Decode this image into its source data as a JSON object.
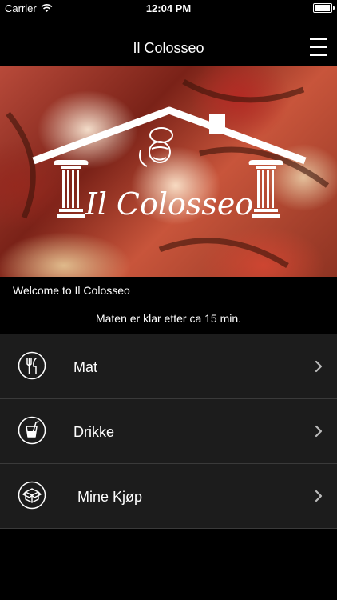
{
  "status_bar": {
    "carrier": "Carrier",
    "time": "12:04 PM"
  },
  "nav": {
    "title": "Il Colosseo",
    "menu_icon": "hamburger-menu-icon"
  },
  "hero": {
    "logo_text": "Il Colosseo"
  },
  "welcome": "Welcome to Il Colosseo",
  "ready_time": "Maten er klar etter ca 15 min.",
  "menu_items": [
    {
      "label": "Mat",
      "icon": "cutlery-icon"
    },
    {
      "label": "Drikke",
      "icon": "drink-icon"
    },
    {
      "label": "Mine Kjøp",
      "icon": "box-icon"
    }
  ]
}
